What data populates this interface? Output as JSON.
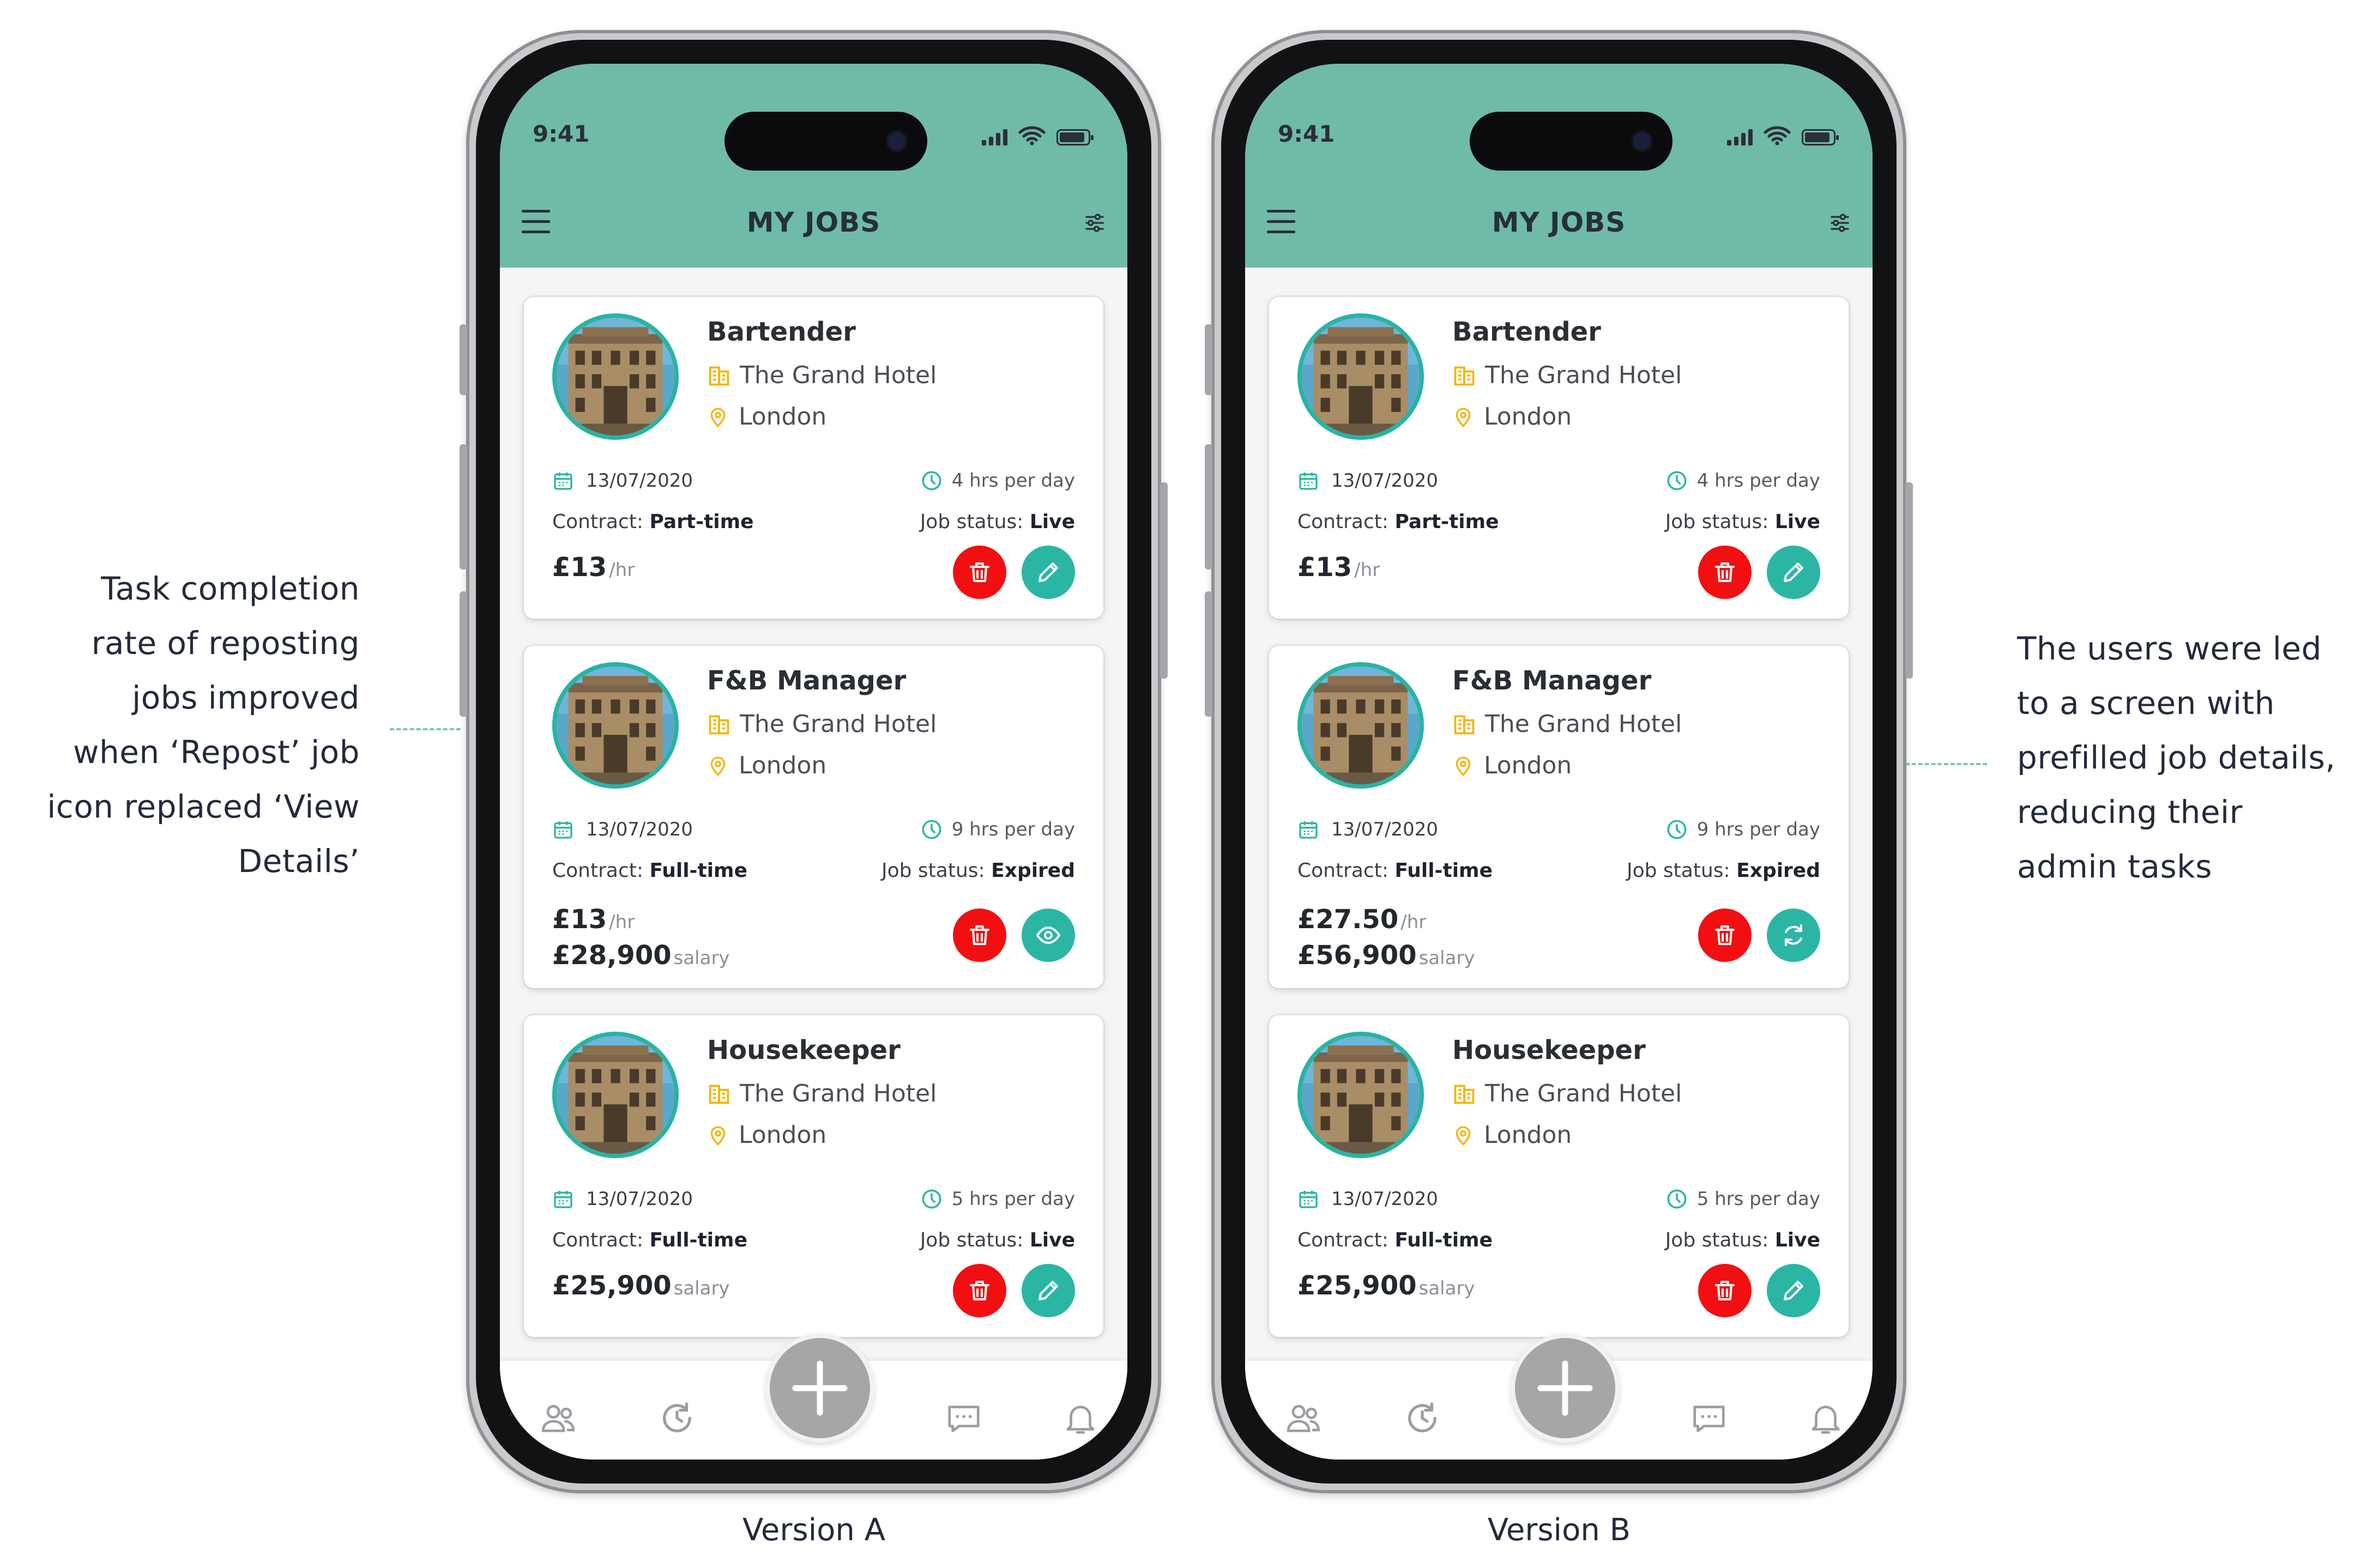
{
  "annotations": {
    "left": [
      "Task completion",
      "rate of reposting",
      "jobs improved",
      "when ‘Repost’ job",
      "icon replaced ‘View",
      "Details’"
    ],
    "right": [
      "The users were led",
      "to a screen with",
      "prefilled job details,",
      "reducing their",
      "admin tasks"
    ]
  },
  "colors": {
    "header_teal": "#6fbba8",
    "accent_teal": "#2bb6a4",
    "delete_red": "#f20f12",
    "company_icon": "#f5b400",
    "fab_gray": "#a6a6a8"
  },
  "phones": [
    {
      "version_label": "Version A",
      "status_time": "9:41",
      "title": "MY JOBS",
      "jobs": [
        {
          "title": "Bartender",
          "company": "The Grand Hotel",
          "location": "London",
          "date": "13/07/2020",
          "hours": "4 hrs per day",
          "contract_label": "Contract:",
          "contract": "Part-time",
          "status_label": "Job status:",
          "status": "Live",
          "pay1": "£13",
          "pay1_unit": "/hr",
          "actions": [
            "trash-icon",
            "pencil-icon"
          ]
        },
        {
          "title": "F&B Manager",
          "company": "The Grand Hotel",
          "location": "London",
          "date": "13/07/2020",
          "hours": "9 hrs per day",
          "contract_label": "Contract:",
          "contract": "Full-time",
          "status_label": "Job status:",
          "status": "Expired",
          "pay1": "£13",
          "pay1_unit": "/hr",
          "pay2": "£28,900",
          "pay2_unit": "salary",
          "actions": [
            "trash-icon",
            "eye-icon"
          ]
        },
        {
          "title": "Housekeeper",
          "company": "The Grand Hotel",
          "location": "London",
          "date": "13/07/2020",
          "hours": "5 hrs per day",
          "contract_label": "Contract:",
          "contract": "Full-time",
          "status_label": "Job status:",
          "status": "Live",
          "pay1": "£25,900",
          "pay1_unit": "salary",
          "actions": [
            "trash-icon",
            "pencil-icon"
          ]
        }
      ],
      "nav": [
        "people-icon",
        "history-icon",
        "plus-icon",
        "chat-icon",
        "bell-icon"
      ]
    },
    {
      "version_label": "Version B",
      "status_time": "9:41",
      "title": "MY JOBS",
      "jobs": [
        {
          "title": "Bartender",
          "company": "The Grand Hotel",
          "location": "London",
          "date": "13/07/2020",
          "hours": "4 hrs per day",
          "contract_label": "Contract:",
          "contract": "Part-time",
          "status_label": "Job status:",
          "status": "Live",
          "pay1": "£13",
          "pay1_unit": "/hr",
          "actions": [
            "trash-icon",
            "pencil-icon"
          ]
        },
        {
          "title": "F&B Manager",
          "company": "The Grand Hotel",
          "location": "London",
          "date": "13/07/2020",
          "hours": "9 hrs per day",
          "contract_label": "Contract:",
          "contract": "Full-time",
          "status_label": "Job status:",
          "status": "Expired",
          "pay1": "£27.50",
          "pay1_unit": "/hr",
          "pay2": "£56,900",
          "pay2_unit": "salary",
          "actions": [
            "trash-icon",
            "repost-icon"
          ]
        },
        {
          "title": "Housekeeper",
          "company": "The Grand Hotel",
          "location": "London",
          "date": "13/07/2020",
          "hours": "5 hrs per day",
          "contract_label": "Contract:",
          "contract": "Full-time",
          "status_label": "Job status:",
          "status": "Live",
          "pay1": "£25,900",
          "pay1_unit": "salary",
          "actions": [
            "trash-icon",
            "pencil-icon"
          ]
        }
      ],
      "nav": [
        "people-icon",
        "history-icon",
        "plus-icon",
        "chat-icon",
        "bell-icon"
      ]
    }
  ]
}
